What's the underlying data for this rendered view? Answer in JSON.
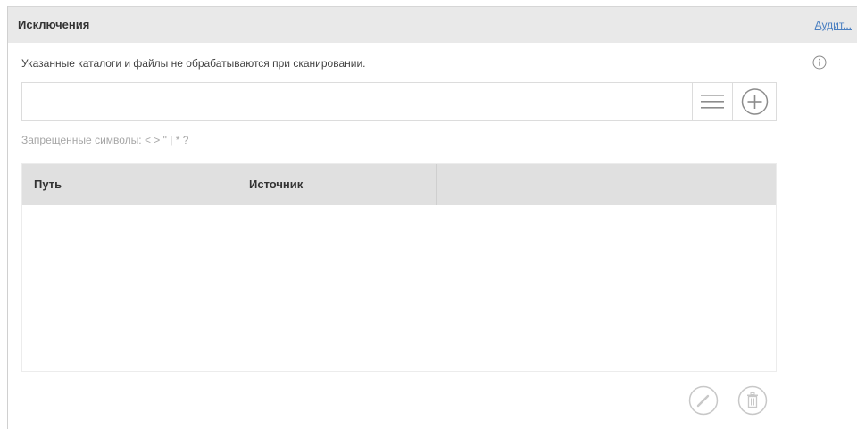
{
  "header": {
    "title": "Исключения",
    "link_label": "Аудит..."
  },
  "description": "Указанные каталоги и файлы не обрабатываются при сканировании.",
  "path_input": {
    "value": "",
    "placeholder": ""
  },
  "hint": "Запрещенные символы: < > \" | * ?",
  "table": {
    "columns": [
      "Путь",
      "Источник",
      ""
    ],
    "rows": []
  },
  "icons": {
    "info": "info-icon",
    "list": "list-icon",
    "add": "plus-circle-icon",
    "edit": "pencil-icon",
    "delete": "trash-icon"
  },
  "colors": {
    "header_bg": "#e9e9e9",
    "link": "#4a7fc1",
    "table_header_bg": "#e0e0e0",
    "hint_text": "#a6a6a6",
    "disabled_icon": "#c8c8c8"
  }
}
